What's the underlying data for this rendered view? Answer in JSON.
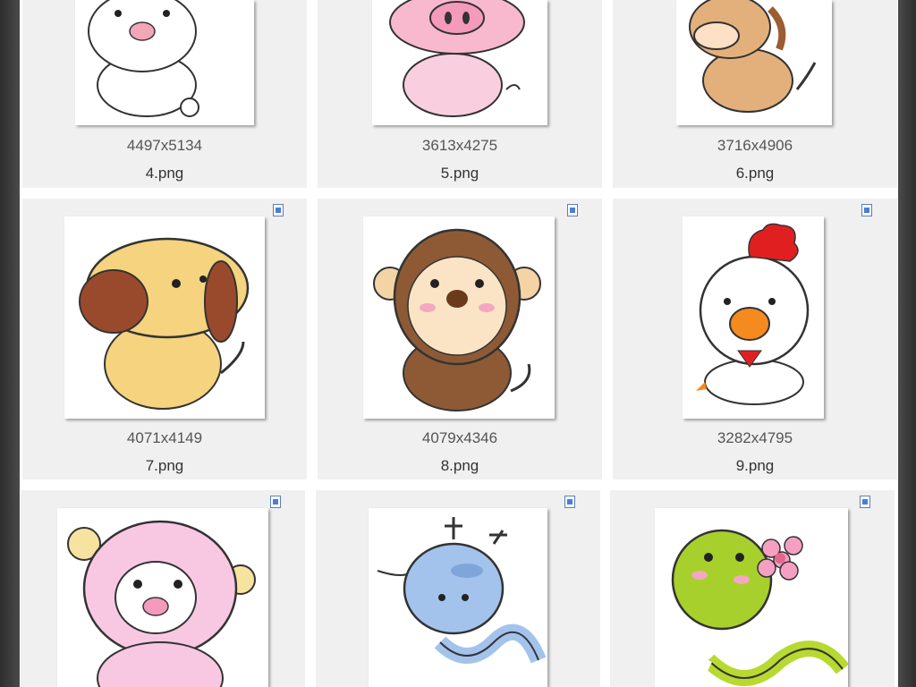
{
  "items": [
    {
      "dims": "4497x5134",
      "name": "4.png",
      "icon": "cat-rabbit-image"
    },
    {
      "dims": "3613x4275",
      "name": "5.png",
      "icon": "pig-image"
    },
    {
      "dims": "3716x4906",
      "name": "6.png",
      "icon": "horse-image"
    },
    {
      "dims": "4071x4149",
      "name": "7.png",
      "icon": "dog-image"
    },
    {
      "dims": "4079x4346",
      "name": "8.png",
      "icon": "monkey-image"
    },
    {
      "dims": "3282x4795",
      "name": "9.png",
      "icon": "rooster-image"
    },
    {
      "dims": "",
      "name": "",
      "icon": "sheep-image"
    },
    {
      "dims": "",
      "name": "",
      "icon": "dragon-image"
    },
    {
      "dims": "",
      "name": "",
      "icon": "snake-image"
    }
  ],
  "colors": {
    "tile": "#f0f0f0",
    "text": "#555555",
    "page": "#404040"
  }
}
